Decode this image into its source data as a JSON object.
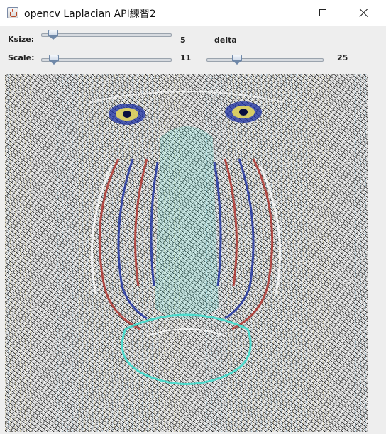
{
  "window": {
    "title": "opencv Laplacian API練習2",
    "icon": "java-coffee-icon",
    "controls": [
      "minimize-icon",
      "maximize-icon",
      "close-icon"
    ]
  },
  "controls": {
    "ksize": {
      "label": "Ksize:",
      "value": "5",
      "position": 0.09
    },
    "delta": {
      "label": "delta",
      "value": "25",
      "position": 0.26
    },
    "scale": {
      "label": "Scale:",
      "value": "11",
      "position": 0.1
    }
  },
  "image": {
    "description_visible": "Laplacian edge-filtered mandrill image",
    "colors": {
      "edge_cyan": "#3de0d0",
      "edge_red": "#b0302a",
      "edge_blue": "#1a2ea0",
      "eye_yellow": "#f2e35a"
    }
  }
}
